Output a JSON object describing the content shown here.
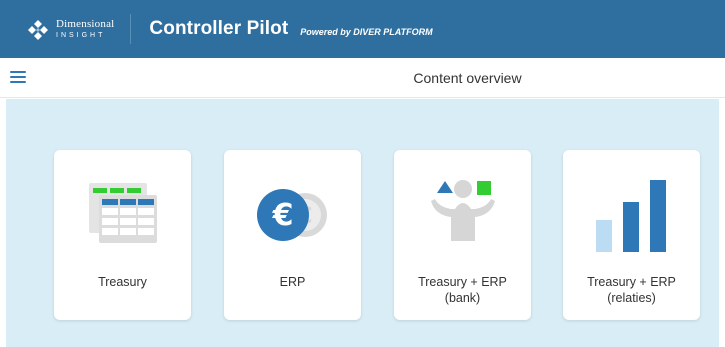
{
  "header": {
    "logo_line1": "Dimensional",
    "logo_line2": "INSIGHT",
    "app_title": "Controller Pilot",
    "powered_by": "Powered by DIVER PLATFORM",
    "bg_color": "#2f6f9f"
  },
  "subbar": {
    "menu_icon": "hamburger-icon",
    "title": "Content overview"
  },
  "tiles": [
    {
      "label_line1": "Treasury",
      "label_line2": "",
      "icon": "spreadsheet-icon"
    },
    {
      "label_line1": "ERP",
      "label_line2": "",
      "icon": "euro-coins-icon"
    },
    {
      "label_line1": "Treasury + ERP",
      "label_line2": "(bank)",
      "icon": "person-balance-icon"
    },
    {
      "label_line1": "Treasury + ERP",
      "label_line2": "(relaties)",
      "icon": "bar-chart-icon"
    }
  ],
  "colors": {
    "accent_blue": "#2e78b8",
    "light_blue": "#bcdcf4",
    "green": "#33cc33",
    "content_bg": "#d9edf7"
  }
}
